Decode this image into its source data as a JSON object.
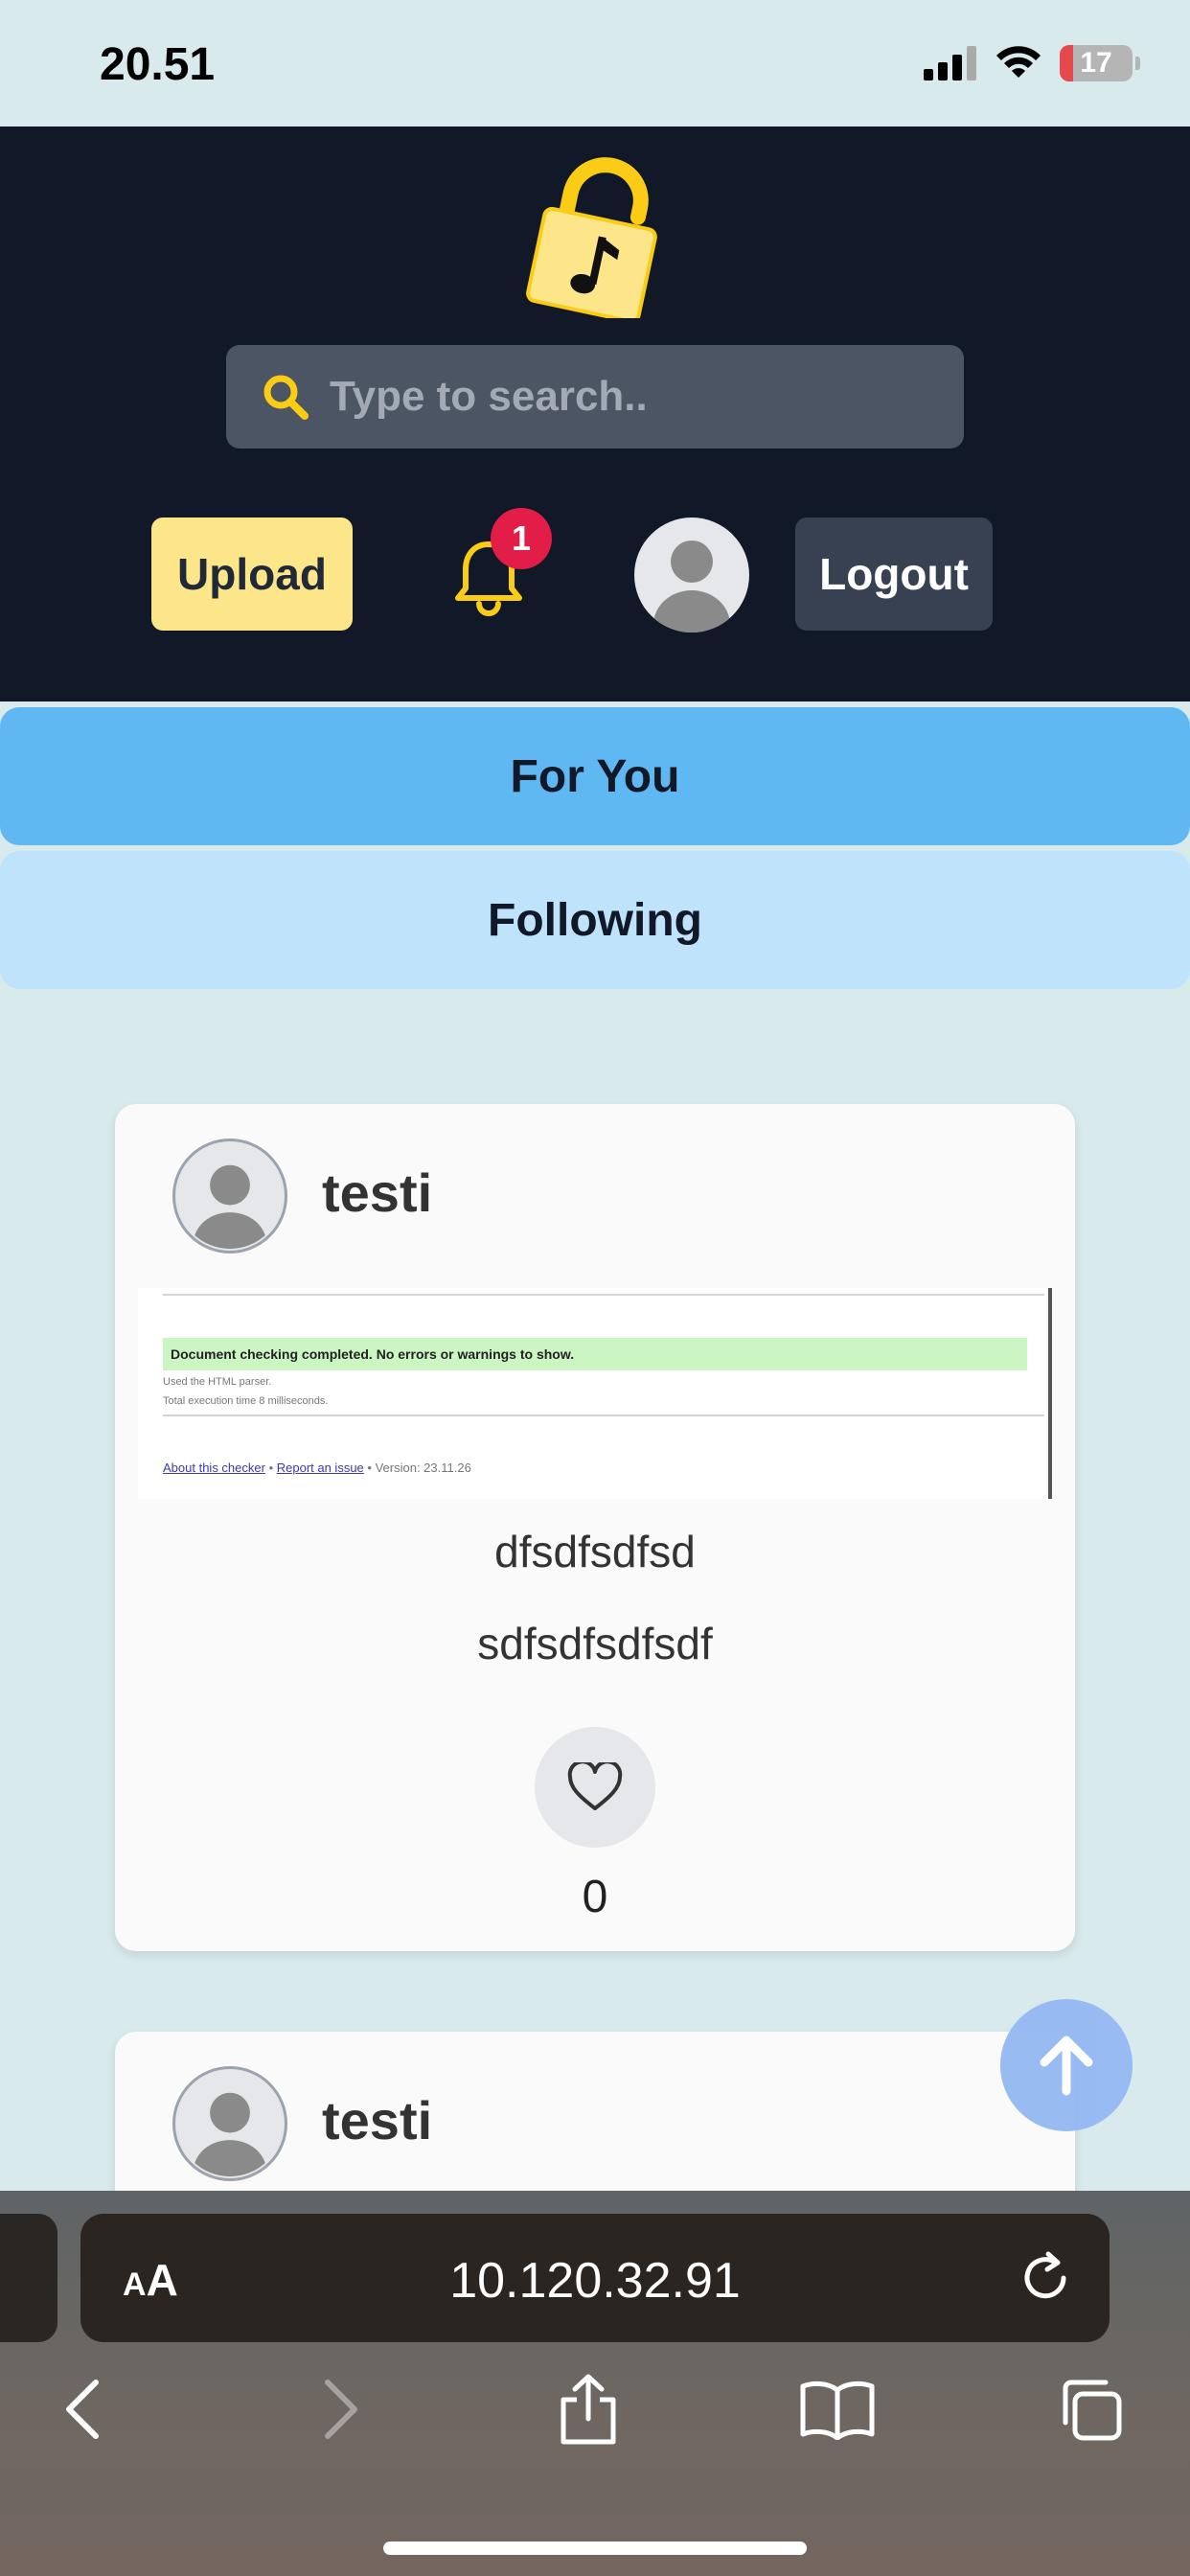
{
  "status_bar": {
    "time": "20.51",
    "battery": "17"
  },
  "header": {
    "search_placeholder": "Type to search..",
    "upload_label": "Upload",
    "notification_count": "1",
    "logout_label": "Logout"
  },
  "feed_tabs": {
    "for_you": "For You",
    "following": "Following"
  },
  "posts": [
    {
      "username": "testi",
      "image": {
        "success_message": "Document checking completed. No errors or warnings to show.",
        "line1": "Used the HTML parser.",
        "line2": "Total execution time 8 milliseconds.",
        "footer_link1": "About this checker",
        "footer_link2": "Report an issue",
        "footer_version": "• Version: 23.11.26"
      },
      "title": "dfsdfsdfsd",
      "description": "sdfsdfsdfsdf",
      "likes": "0"
    },
    {
      "username": "testi"
    }
  ],
  "browser": {
    "aa_small": "A",
    "aa_big": "A",
    "url": "10.120.32.91"
  },
  "colors": {
    "page_bg": "#d9eaec",
    "header_bg": "#111827",
    "upload_bg": "#fde68a",
    "accent_yellow": "#facc15",
    "for_you_tab": "#60b8f2",
    "following_tab": "#bfe3fa",
    "badge_red": "#e11d48"
  }
}
